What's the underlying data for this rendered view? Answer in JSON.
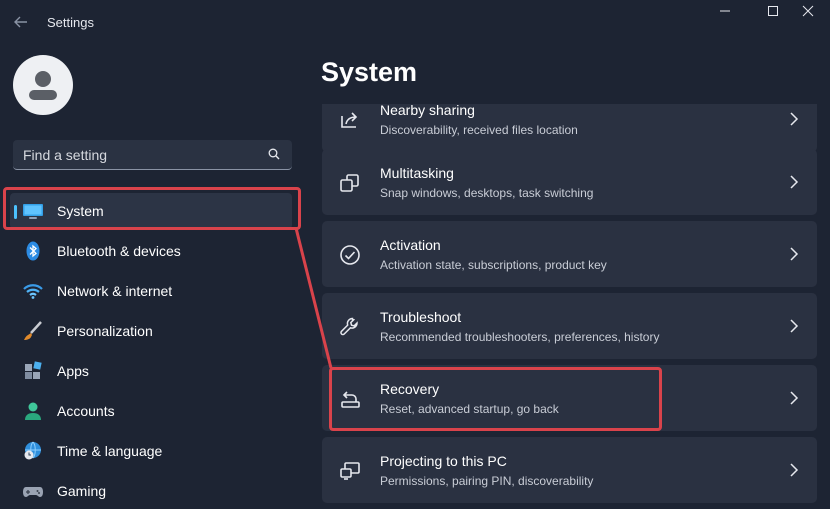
{
  "app": {
    "title": "Settings"
  },
  "search": {
    "placeholder": "Find a setting"
  },
  "sidebar": {
    "items": [
      {
        "label": "System",
        "icon": "monitor-icon",
        "active": true
      },
      {
        "label": "Bluetooth & devices",
        "icon": "bluetooth-icon"
      },
      {
        "label": "Network & internet",
        "icon": "wifi-icon"
      },
      {
        "label": "Personalization",
        "icon": "brush-icon"
      },
      {
        "label": "Apps",
        "icon": "apps-icon"
      },
      {
        "label": "Accounts",
        "icon": "person-icon"
      },
      {
        "label": "Time & language",
        "icon": "globe-clock-icon"
      },
      {
        "label": "Gaming",
        "icon": "gamepad-icon"
      }
    ]
  },
  "main": {
    "title": "System",
    "items": [
      {
        "title": "Nearby sharing",
        "subtitle": "Discoverability, received files location",
        "icon": "share-icon"
      },
      {
        "title": "Multitasking",
        "subtitle": "Snap windows, desktops, task switching",
        "icon": "multitasking-icon"
      },
      {
        "title": "Activation",
        "subtitle": "Activation state, subscriptions, product key",
        "icon": "check-circle-icon"
      },
      {
        "title": "Troubleshoot",
        "subtitle": "Recommended troubleshooters, preferences, history",
        "icon": "wrench-icon"
      },
      {
        "title": "Recovery",
        "subtitle": "Reset, advanced startup, go back",
        "icon": "recovery-icon"
      },
      {
        "title": "Projecting to this PC",
        "subtitle": "Permissions, pairing PIN, discoverability",
        "icon": "projecting-icon"
      }
    ]
  },
  "colors": {
    "accent": "#4cc2ff",
    "highlight": "#d9434b",
    "background": "#1d2433",
    "card": "#2a3141"
  }
}
